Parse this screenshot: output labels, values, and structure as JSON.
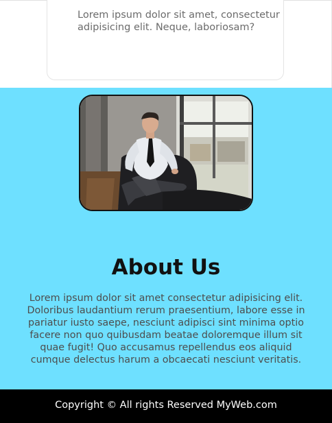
{
  "testimonial": {
    "text": "Lorem ipsum dolor sit amet, consectetur adipisicing elit. Neque, laboriosam?"
  },
  "about": {
    "image_alt": "businessman seated by window",
    "title": "About Us",
    "body": "Lorem ipsum dolor sit amet consectetur adipisicing elit. Doloribus laudantium rerum praesentium, labore esse in pariatur iusto saepe, nesciunt adipisci sint minima optio facere non quo quibusdam beatae doloremque illum sit quae fugit! Quo accusamus repellendus eos aliquid cumque delectus harum a obcaecati nesciunt veritatis."
  },
  "footer": {
    "copyright": "Copyright © All rights Reserved MyWeb.com"
  },
  "colors": {
    "about_bg": "#6ee0ff",
    "footer_bg": "#000000",
    "title": "#111111",
    "body_text": "#4d4d4d"
  }
}
